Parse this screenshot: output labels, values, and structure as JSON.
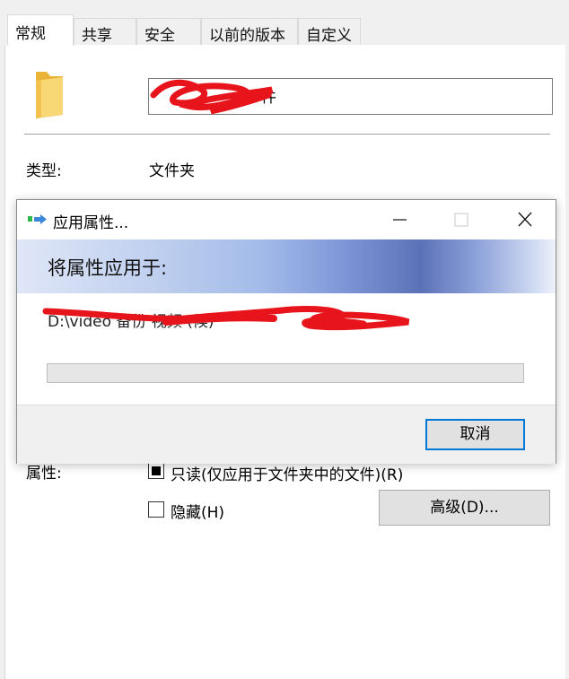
{
  "tabs": [
    {
      "label": "常规",
      "active": true
    },
    {
      "label": "共享"
    },
    {
      "label": "安全"
    },
    {
      "label": "以前的版本"
    },
    {
      "label": "自定义"
    }
  ],
  "general": {
    "folder_name": "件",
    "type_label": "类型:",
    "type_value": "文件夹",
    "attributes_label": "属性:",
    "readonly_label": "只读(仅应用于文件夹中的文件)(R)",
    "readonly_state": "indeterminate",
    "hidden_label": "隐藏(H)",
    "hidden_checked": false,
    "advanced_button": "高级(D)..."
  },
  "dialog": {
    "title": "应用属性...",
    "heading": "将属性应用于:",
    "path": "D:\\video 备份 视频 (候)",
    "progress": 0,
    "cancel_button": "取消"
  },
  "colors": {
    "accent": "#0078d7",
    "folder": "#f3c755",
    "redaction": "#e8141b"
  }
}
